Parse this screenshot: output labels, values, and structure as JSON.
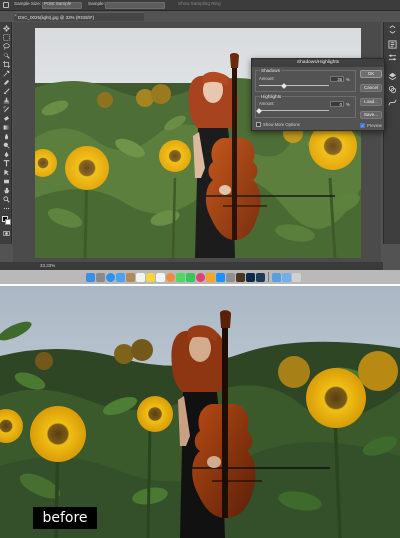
{
  "photoshop": {
    "options_bar": {
      "sample_size_label": "Sample Size:",
      "sample_size_value": "Point Sample",
      "sample_label": "Sample:",
      "show_sampling_ring": "Show Sampling Ring"
    },
    "document_tab": "DSC_0025(light).jpg @ 33% (RGB/8*)",
    "status_text": "33.33%",
    "accent_color": "#3f79d8"
  },
  "dialog": {
    "title": "Shadows/Highlights",
    "shadows": {
      "label": "Shadows",
      "amount_label": "Amount:",
      "amount_value": "35",
      "amount_fraction": 0.35,
      "unit": "%"
    },
    "highlights": {
      "label": "Highlights",
      "amount_label": "Amount:",
      "amount_value": "0",
      "amount_fraction": 0.0,
      "unit": "%"
    },
    "show_more_options": "Show More Options",
    "buttons": {
      "ok": "OK",
      "cancel": "Cancel",
      "load": "Load...",
      "save": "Save..."
    },
    "preview": {
      "label": "Preview",
      "checked": true
    }
  },
  "dock": {
    "icons": [
      "finder-icon",
      "launchpad-icon",
      "safari-icon",
      "mail-icon",
      "contacts-icon",
      "calendar-icon",
      "notes-icon",
      "reminders-icon",
      "photos-icon",
      "messages-icon",
      "facetime-icon",
      "itunes-icon",
      "ibooks-icon",
      "app-store-icon",
      "system-preferences-icon",
      "bridge-icon",
      "photoshop-icon",
      "lightroom-icon",
      "folder-icon",
      "downloads-icon",
      "trash-icon"
    ]
  },
  "before_caption": "before"
}
